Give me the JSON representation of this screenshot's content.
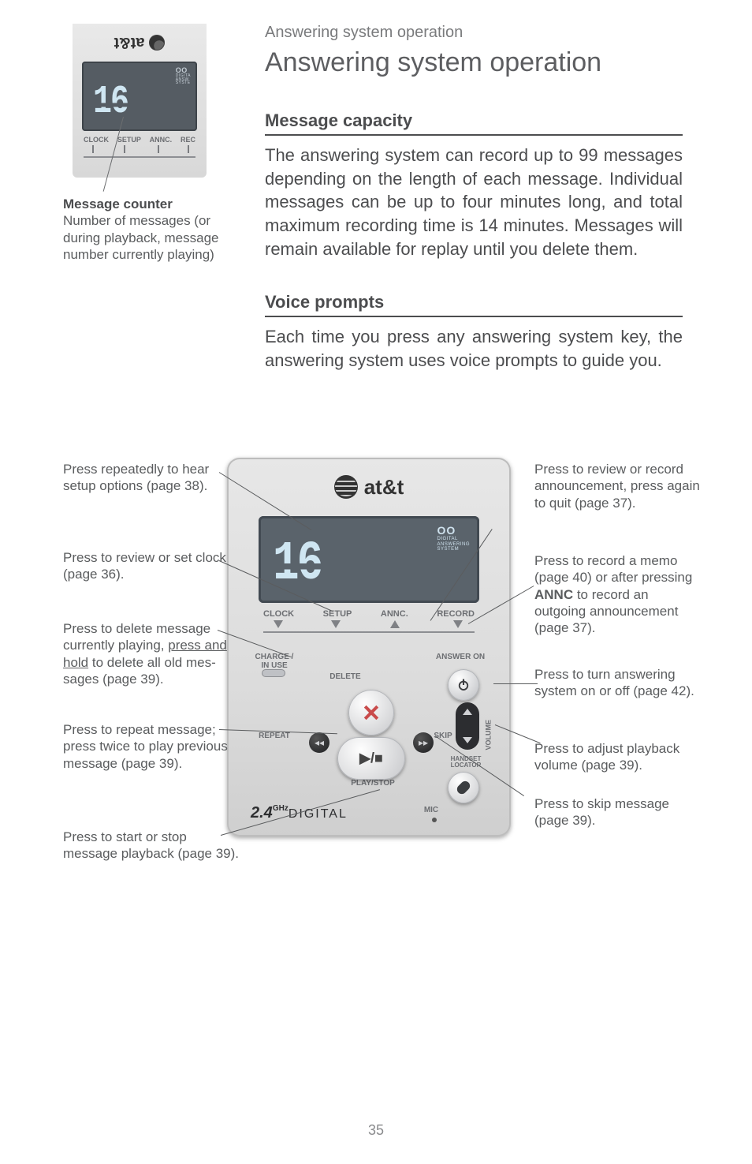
{
  "breadcrumb": "Answering system operation",
  "h1": "Answering system operation",
  "sections": {
    "capacity": {
      "title": "Message capacity",
      "body": "The answering system can record up to 99 messages depending on the length of each message. Individual messages can be up to four minutes long, and total maximum recording time is 14 minutes. Messages will remain available for replay until you delete them."
    },
    "voice": {
      "title": "Voice prompts",
      "body": "Each time you press any answering system key, the answering system uses voice prompts to guide you."
    }
  },
  "mini": {
    "logo": "at&t",
    "reel_icon": "OO",
    "reel_text_1": "DIGITA",
    "reel_text_2": "ANSW",
    "reel_text_3": "SYSTE",
    "number": "16",
    "labels": {
      "clock": "CLOCK",
      "setup": "SETUP",
      "annc": "ANNC.",
      "rec": "REC"
    },
    "caption_title": "Message counter",
    "caption_body": "Number of messages (or during playback, mes­sage number currently playing)"
  },
  "device": {
    "logo": "at&t",
    "reel_icon": "OO",
    "reel_text_1": "DIGITAL",
    "reel_text_2": "ANSWERING",
    "reel_text_3": "SYSTEM",
    "number": "16",
    "labels": {
      "clock": "CLOCK",
      "setup": "SETUP",
      "annc": "ANNC.",
      "record": "RECORD",
      "charge": "CHARGE / IN USE",
      "answer_on": "ANSWER ON",
      "delete": "DELETE",
      "repeat": "REPEAT",
      "skip": "SKIP",
      "play_stop": "PLAY/STOP",
      "handset_locator": "HANDSET LOCATOR",
      "volume": "VOLUME",
      "mic": "MIC"
    },
    "play_glyph": "▶/■",
    "brand_24": "2.4",
    "brand_ghz": "GHz",
    "brand_digital": "DIGITAL"
  },
  "callouts": {
    "left": {
      "setup": "Press repeatedly to hear setup options (page 38).",
      "clock": "Press to review or set clock (page 36).",
      "delete_a": "Press to delete mes­sage currently play­ing, ",
      "delete_u": "press and hold",
      "delete_b": " to delete all old mes­sages (page 39).",
      "repeat": "Press to repeat mes­sage; press twice to play previous mes­sage (page 39).",
      "play": "Press to start or stop message playback (page 39)."
    },
    "right": {
      "annc": "Press to review or record announcement, press again to quit (page 37).",
      "record_a": "Press to record a memo (page 40) or after pressing ",
      "record_b": "ANNC",
      "record_c": " to record an outgoing announcement (page 37).",
      "answer": "Press to turn answer­ing system on or off (page 42).",
      "volume": "Press to adjust play­back volume (page 39).",
      "skip": "Press to skip message (page 39)."
    }
  },
  "page_number": "35"
}
